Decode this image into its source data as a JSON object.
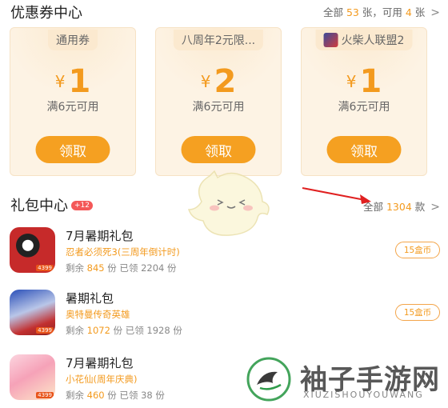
{
  "coupon_section": {
    "title": "优惠券中心",
    "summary_prefix": "全部",
    "total": "53",
    "summary_mid": "张，可用",
    "available": "4",
    "summary_suffix": "张",
    "chevron": ">"
  },
  "coupons": [
    {
      "tag": "通用券",
      "currency": "¥",
      "amount": "1",
      "condition": "满6元可用",
      "button": "领取"
    },
    {
      "tag": "八周年2元限...",
      "currency": "¥",
      "amount": "2",
      "condition": "满6元可用",
      "button": "领取"
    },
    {
      "tag": "火柴人联盟2",
      "currency": "¥",
      "amount": "1",
      "condition": "满6元可用",
      "button": "领取"
    }
  ],
  "gift_section": {
    "title": "礼包中心",
    "badge": "+12",
    "summary_prefix": "全部",
    "total": "1304",
    "summary_suffix": "款",
    "chevron": ">"
  },
  "packs": [
    {
      "title": "7月暑期礼包",
      "game": "忍者必须死3(三周年倒计时)",
      "remain_label": "剩余",
      "remain": "845",
      "unit1": "份",
      "claimed_label": "已领",
      "claimed": "2204",
      "unit2": "份",
      "price": "15盒币",
      "thumb_badge": "4399"
    },
    {
      "title": "暑期礼包",
      "game": "奥特曼传奇英雄",
      "remain_label": "剩余",
      "remain": "1072",
      "unit1": "份",
      "claimed_label": "已领",
      "claimed": "1928",
      "unit2": "份",
      "price": "15盒币",
      "thumb_badge": "4399"
    },
    {
      "title": "7月暑期礼包",
      "game": "小花仙(周年庆典)",
      "remain_label": "剩余",
      "remain": "460",
      "unit1": "份",
      "claimed_label": "已领",
      "claimed": "38",
      "unit2": "份",
      "price": "",
      "thumb_badge": "4399"
    }
  ],
  "watermark": {
    "title": "袖子手游网",
    "subtitle": "XIUZISHOUYOUWANG"
  },
  "colors": {
    "accent": "#f39a1e",
    "button": "#f5a021",
    "card_bg": "#fdf3e4",
    "badge_red": "#f45858",
    "arrow_red": "#e02020"
  },
  "icons": [
    "chevron-right-icon",
    "red-arrow-annotation",
    "mascot-sticker",
    "watermark-logo"
  ]
}
